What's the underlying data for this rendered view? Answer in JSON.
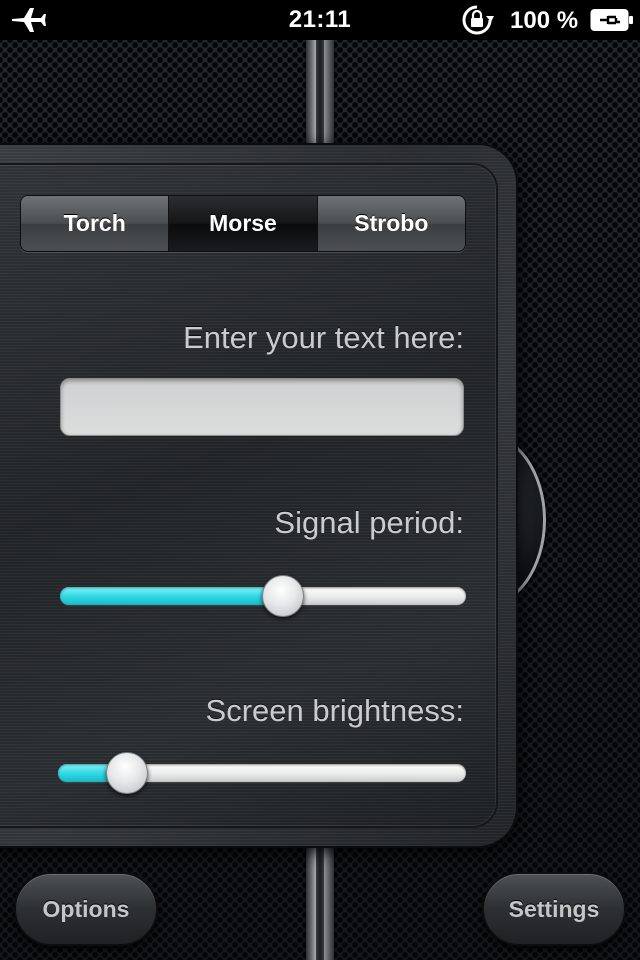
{
  "status_bar": {
    "time": "21:11",
    "battery_text": "100 %",
    "icons": [
      "airplane-icon",
      "orientation-lock-icon",
      "battery-charging-icon"
    ]
  },
  "segmented": {
    "items": [
      {
        "label": "Torch"
      },
      {
        "label": "Morse"
      },
      {
        "label": "Strobo"
      }
    ],
    "selected": "Morse"
  },
  "text_field": {
    "label": "Enter your text here:",
    "value": "",
    "placeholder": ""
  },
  "signal_period": {
    "label": "Signal period:",
    "value": 0.55
  },
  "screen_brightness": {
    "label": "Screen brightness:",
    "value": 0.17
  },
  "buttons": {
    "options": "Options",
    "settings": "Settings"
  },
  "colors": {
    "slider_fill": "#2fd6e2",
    "selected_segment": "#141516"
  }
}
